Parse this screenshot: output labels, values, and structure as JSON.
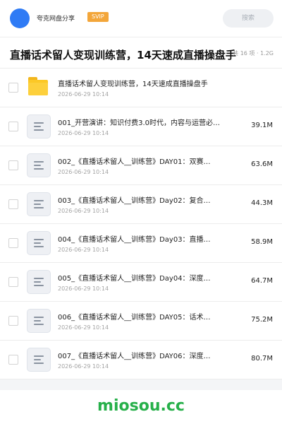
{
  "header": {
    "brand": "夸克网盘分享",
    "badge": "SVIP",
    "search_placeholder": "搜索"
  },
  "folder": {
    "title": "直播话术留人变现训练营，14天速成直播操盘手",
    "meta": "共 16 项 · 1.2G"
  },
  "files": [
    {
      "name": "直播话术留人变现训练营，14天速成直播操盘手",
      "date": "2026-06-29 10:14",
      "size": "",
      "icon": "folder-icon"
    },
    {
      "name": "001_开营演讲：知识付费3.0时代，内容与运营必…",
      "date": "2026-06-29 10:14",
      "size": "39.1M",
      "icon": "file-icon"
    },
    {
      "name": "002_《直播话术留人__训练营》DAY01：双赛…",
      "date": "2026-06-29 10:14",
      "size": "63.6M",
      "icon": "file-icon"
    },
    {
      "name": "003_《直播话术留人__训练营》Day02：复合…",
      "date": "2026-06-29 10:14",
      "size": "44.3M",
      "icon": "file-icon"
    },
    {
      "name": "004_《直播话术留人__训练营》Day03：直播…",
      "date": "2026-06-29 10:14",
      "size": "58.9M",
      "icon": "file-icon"
    },
    {
      "name": "005_《直播话术留人__训练营》Day04：深度…",
      "date": "2026-06-29 10:14",
      "size": "64.7M",
      "icon": "file-icon"
    },
    {
      "name": "006_《直播话术留人__训练营》DAY05：话术…",
      "date": "2026-06-29 10:14",
      "size": "75.2M",
      "icon": "file-icon"
    },
    {
      "name": "007_《直播话术留人__训练营》DAY06：深度…",
      "date": "2026-06-29 10:14",
      "size": "80.7M",
      "icon": "file-icon"
    }
  ],
  "footer": {
    "watermark": "miosou.cc"
  },
  "colors": {
    "accent": "#2f7bf5",
    "badge": "#f3a63a",
    "watermark": "#27b04a",
    "folder": "#fcc826"
  }
}
